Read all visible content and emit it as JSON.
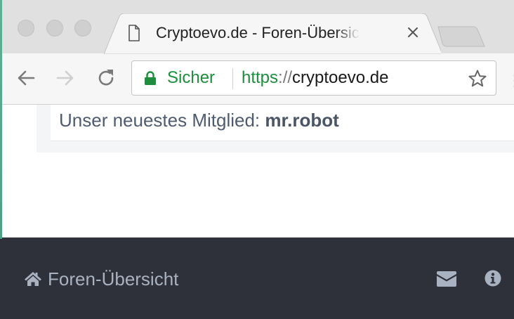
{
  "browser": {
    "tab": {
      "title": "Cryptoevo.de - Foren-Übersicht",
      "icon": "document-icon"
    },
    "toolbar": {
      "back_icon": "arrow-left-icon",
      "forward_icon": "arrow-right-icon",
      "reload_icon": "reload-icon",
      "bookmark_icon": "star-icon"
    },
    "address_bar": {
      "security_label": "Sicher",
      "url_scheme": "https",
      "url_separator": "://",
      "url_host": "cryptoevo.de",
      "secure_color": "#1e8e3e"
    }
  },
  "page": {
    "newest_member": {
      "label": "Unser neuestes Mitglied:",
      "username": "mr.robot"
    },
    "footer": {
      "home_label": "Foren-Übersicht",
      "home_icon": "home-icon",
      "mail_icon": "envelope-icon",
      "info_icon": "info-icon",
      "background": "#2e3139"
    }
  }
}
